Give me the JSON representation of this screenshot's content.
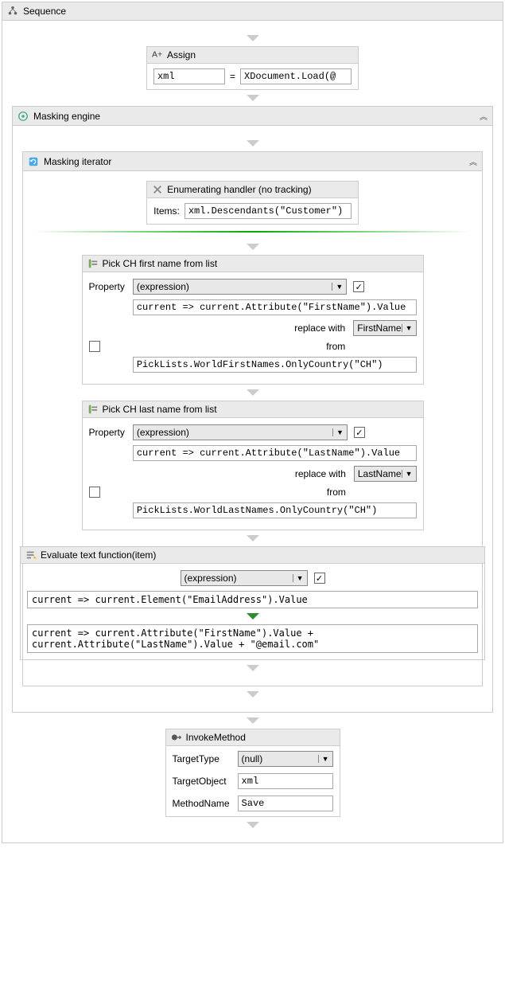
{
  "sequence": {
    "title": "Sequence"
  },
  "assign": {
    "title": "Assign",
    "left": "xml",
    "equals": "=",
    "right": "XDocument.Load(@"
  },
  "masking_engine": {
    "title": "Masking engine"
  },
  "masking_iterator": {
    "title": "Masking iterator"
  },
  "enum_handler": {
    "title": "Enumerating handler (no tracking)",
    "items_label": "Items:",
    "items_value": "xml.Descendants(\"Customer\")"
  },
  "pick1": {
    "title": "Pick CH first name from list",
    "property_label": "Property",
    "property_combo": "(expression)",
    "property_checked": "✓",
    "expr": "current => current.Attribute(\"FirstName\").Value",
    "replace_label": "replace with",
    "replace_combo": "FirstName",
    "replace_checked": "",
    "from_label": "from",
    "from_value": "PickLists.WorldFirstNames.OnlyCountry(\"CH\")"
  },
  "pick2": {
    "title": "Pick CH last name from list",
    "property_label": "Property",
    "property_combo": "(expression)",
    "property_checked": "✓",
    "expr": "current => current.Attribute(\"LastName\").Value",
    "replace_label": "replace with",
    "replace_combo": "LastName",
    "replace_checked": "",
    "from_label": "from",
    "from_value": "PickLists.WorldLastNames.OnlyCountry(\"CH\")"
  },
  "eval": {
    "title": "Evaluate text function(item)",
    "combo": "(expression)",
    "checked": "✓",
    "expr1": "current => current.Element(\"EmailAddress\").Value",
    "expr2": "current => current.Attribute(\"FirstName\").Value + current.Attribute(\"LastName\").Value + \"@email.com\""
  },
  "invoke": {
    "title": "InvokeMethod",
    "target_type_label": "TargetType",
    "target_type_value": "(null)",
    "target_object_label": "TargetObject",
    "target_object_value": "xml",
    "method_name_label": "MethodName",
    "method_name_value": "Save"
  }
}
